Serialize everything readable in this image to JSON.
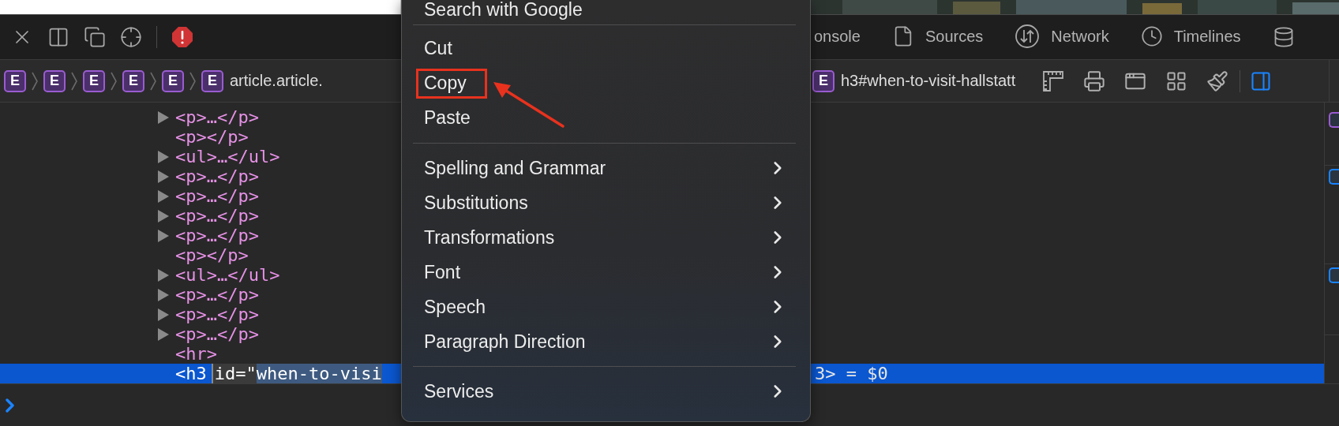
{
  "toolbar": {
    "tabs": [
      {
        "label": "onsole",
        "selected": false
      },
      {
        "label": "Sources",
        "selected": false
      },
      {
        "label": "Network",
        "selected": false
      },
      {
        "label": "Timelines",
        "selected": false
      }
    ]
  },
  "breadcrumbs": {
    "left": [
      {
        "badge": "E"
      },
      {
        "badge": "E"
      },
      {
        "badge": "E"
      },
      {
        "badge": "E"
      },
      {
        "badge": "E"
      },
      {
        "badge": "E",
        "label": "article.article."
      }
    ],
    "right": [
      {
        "badge": "E",
        "label": "h3#when-to-visit-hallstatt"
      }
    ]
  },
  "dom_tree": {
    "rows": [
      {
        "text": "<p>…</p>",
        "expandable": true,
        "selected": false
      },
      {
        "text": "<p></p>",
        "expandable": false,
        "selected": false
      },
      {
        "text": "<ul>…</ul>",
        "expandable": true,
        "selected": false
      },
      {
        "text": "<p>…</p>",
        "expandable": true,
        "selected": false
      },
      {
        "text": "<p>…</p>",
        "expandable": true,
        "selected": false
      },
      {
        "text": "<p>…</p>",
        "expandable": true,
        "selected": false
      },
      {
        "text": "<p>…</p>",
        "expandable": true,
        "selected": false
      },
      {
        "text": "<p></p>",
        "expandable": false,
        "selected": false
      },
      {
        "text": "<ul>…</ul>",
        "expandable": true,
        "selected": false
      },
      {
        "text": "<p>…</p>",
        "expandable": true,
        "selected": false
      },
      {
        "text": "<p>…</p>",
        "expandable": true,
        "selected": false
      },
      {
        "text": "<p>…</p>",
        "expandable": true,
        "selected": false
      },
      {
        "text": "<hr>",
        "expandable": false,
        "selected": false
      },
      {
        "text": "<h3",
        "expandable": false,
        "selected": true,
        "attribute": {
          "name": "id=\"",
          "value": "when-to-visi"
        },
        "tail": "3> = $0"
      }
    ]
  },
  "context_menu": {
    "items": [
      {
        "kind": "item",
        "label": "Search with Google",
        "submenu": false,
        "highlighted": false
      },
      {
        "kind": "separator"
      },
      {
        "kind": "item",
        "label": "Cut",
        "submenu": false,
        "highlighted": false
      },
      {
        "kind": "item",
        "label": "Copy",
        "submenu": false,
        "highlighted": true
      },
      {
        "kind": "item",
        "label": "Paste",
        "submenu": false,
        "highlighted": false
      },
      {
        "kind": "separator"
      },
      {
        "kind": "item",
        "label": "Spelling and Grammar",
        "submenu": true,
        "highlighted": false
      },
      {
        "kind": "item",
        "label": "Substitutions",
        "submenu": true,
        "highlighted": false
      },
      {
        "kind": "item",
        "label": "Transformations",
        "submenu": true,
        "highlighted": false
      },
      {
        "kind": "item",
        "label": "Font",
        "submenu": true,
        "highlighted": false
      },
      {
        "kind": "item",
        "label": "Speech",
        "submenu": true,
        "highlighted": false
      },
      {
        "kind": "item",
        "label": "Paragraph Direction",
        "submenu": true,
        "highlighted": false
      },
      {
        "kind": "separator"
      },
      {
        "kind": "item",
        "label": "Services",
        "submenu": true,
        "highlighted": false
      }
    ]
  }
}
